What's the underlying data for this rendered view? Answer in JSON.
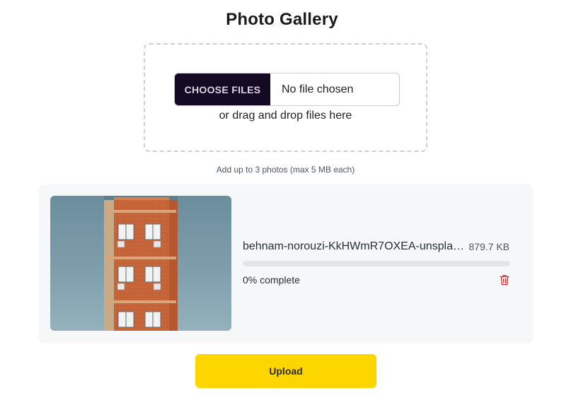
{
  "page": {
    "title": "Photo Gallery"
  },
  "dropzone": {
    "choose_label": "CHOOSE FILES",
    "file_status": "No file chosen",
    "drag_text": "or drag and drop files here"
  },
  "hint": "Add up to 3 photos (max 5 MB each)",
  "files": [
    {
      "name": "behnam-norouzi-KkHWmR7OXEA-unsplash.jpg",
      "size": "879.7 KB",
      "progress_text": "0% complete",
      "progress_fraction": 0,
      "thumbnail_icon": "building-photo"
    }
  ],
  "actions": {
    "upload_label": "Upload",
    "delete_icon": "trash-icon"
  },
  "colors": {
    "choose_button_bg": "#140a23",
    "upload_button_bg": "#fdd600",
    "delete_icon": "#dc2626",
    "progress_track": "#e3e5e9"
  }
}
